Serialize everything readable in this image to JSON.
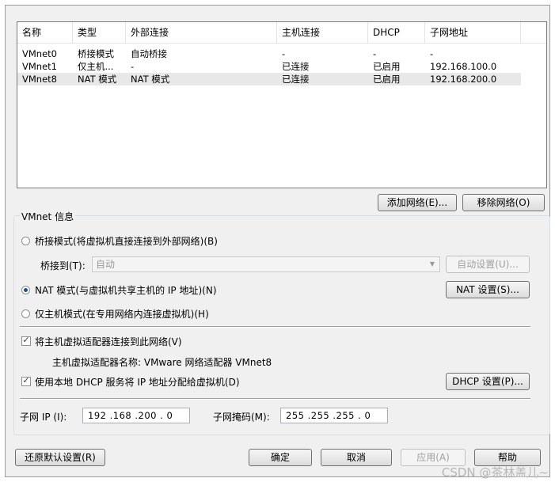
{
  "columns": [
    "名称",
    "类型",
    "外部连接",
    "主机连接",
    "DHCP",
    "子网地址"
  ],
  "rows": [
    {
      "name": "VMnet0",
      "type": "桥接模式",
      "ext": "自动桥接",
      "host": "-",
      "dhcp": "-",
      "subnet": "-"
    },
    {
      "name": "VMnet1",
      "type": "仅主机...",
      "ext": "-",
      "host": "已连接",
      "dhcp": "已启用",
      "subnet": "192.168.100.0"
    },
    {
      "name": "VMnet8",
      "type": "NAT 模式",
      "ext": "NAT 模式",
      "host": "已连接",
      "dhcp": "已启用",
      "subnet": "192.168.200.0"
    }
  ],
  "buttons": {
    "add_network": "添加网络(E)...",
    "remove_network": "移除网络(O)",
    "auto_settings": "自动设置(U)...",
    "nat_settings": "NAT 设置(S)...",
    "dhcp_settings": "DHCP 设置(P)...",
    "restore_defaults": "还原默认设置(R)",
    "ok": "确定",
    "cancel": "取消",
    "apply": "应用(A)",
    "help": "帮助"
  },
  "vmnet_info": {
    "title": "VMnet 信息",
    "bridged_label": "桥接模式(将虚拟机直接连接到外部网络)(B)",
    "bridge_to_label": "桥接到(T):",
    "bridge_to_value": "自动",
    "nat_label": "NAT 模式(与虚拟机共享主机的 IP 地址)(N)",
    "hostonly_label": "仅主机模式(在专用网络内连接虚拟机)(H)",
    "connect_adapter_label": "将主机虚拟适配器连接到此网络(V)",
    "adapter_name_text": "主机虚拟适配器名称: VMware 网络适配器 VMnet8",
    "use_dhcp_label": "使用本地 DHCP 服务将 IP 地址分配给虚拟机(D)",
    "subnet_ip_label": "子网 IP (I):",
    "subnet_ip_value": "192 .168 .200 .  0",
    "subnet_mask_label": "子网掩码(M):",
    "subnet_mask_value": "255 .255 .255 .  0"
  },
  "selected_mode": "nat",
  "connect_adapter_checked": true,
  "use_dhcp_checked": true,
  "watermark": "CSDN @茶林盖儿~",
  "colors": {
    "radio_dot": "#1a4e9a",
    "selected_row": "#e8e8e8",
    "dialog_bg": "#f0f0f0"
  }
}
